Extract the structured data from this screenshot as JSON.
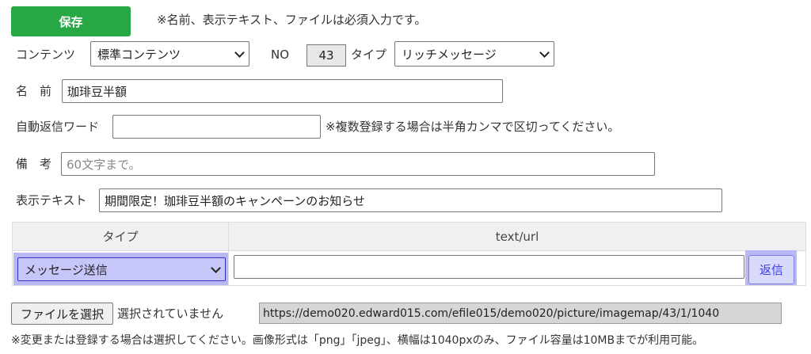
{
  "header": {
    "save_label": "保存",
    "required_note": "※名前、表示テキスト、ファイルは必須入力です。"
  },
  "contents": {
    "label": "コンテンツ",
    "selected": "標準コンテンツ",
    "no_label": "NO",
    "no_value": "43",
    "type_label": "タイプ",
    "type_selected": "リッチメッセージ"
  },
  "name": {
    "label": "名　前",
    "value": "珈琲豆半額"
  },
  "auto_reply": {
    "label": "自動返信ワード",
    "value": "",
    "note": "※複数登録する場合は半角カンマで区切ってください。"
  },
  "remarks": {
    "label": "備　考",
    "placeholder": "60文字まで。"
  },
  "display_text": {
    "label": "表示テキスト",
    "value": "期間限定！珈琲豆半額のキャンペーンのお知らせ"
  },
  "table": {
    "headers": [
      "タイプ",
      "text/url"
    ],
    "row": {
      "type_selected": "メッセージ送信",
      "text_value": "",
      "reply_button": "返信"
    }
  },
  "file": {
    "choose_label": "ファイルを選択",
    "status": "選択されていません",
    "url": "https://demo020.edward015.com/efile015/demo020/picture/imagemap/43/1/1040",
    "note": "※変更または登録する場合は選択してください。画像形式は「png」「jpeg」、横幅は1040pxのみ、ファイル容量は10MBまでが利用可能。"
  }
}
